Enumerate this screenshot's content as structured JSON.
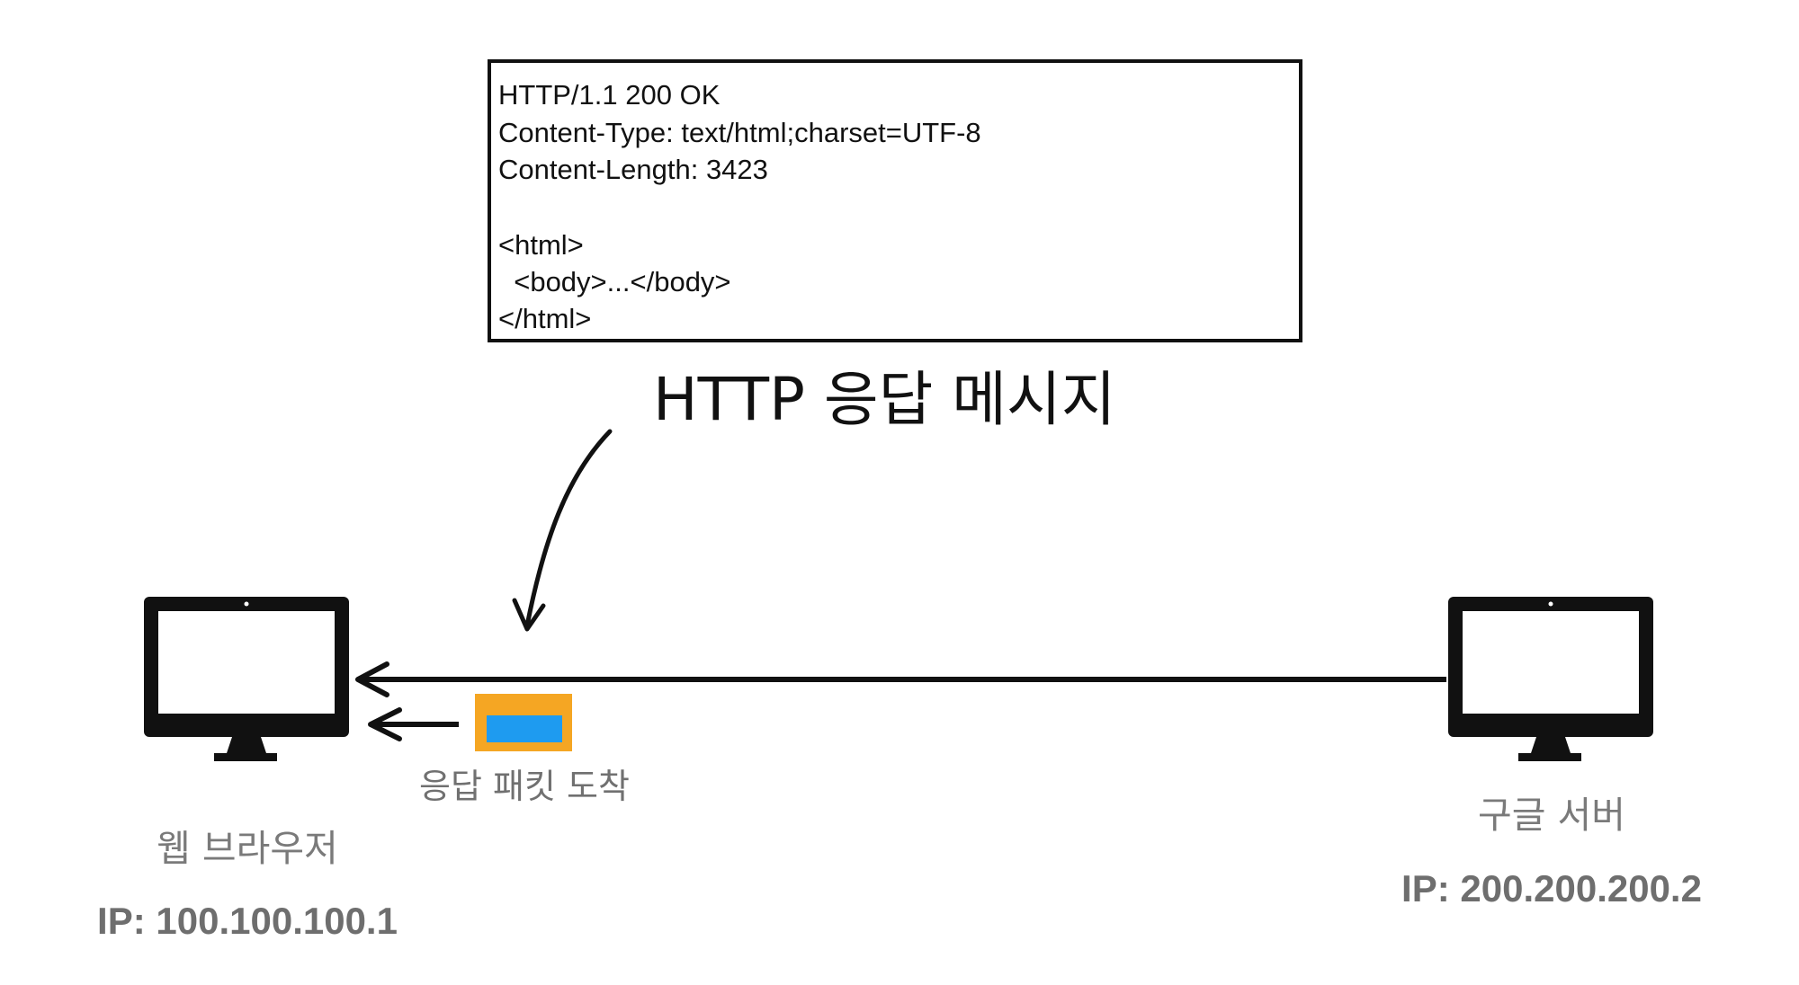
{
  "message": {
    "lines": [
      "HTTP/1.1 200 OK",
      "Content-Type: text/html;charset=UTF-8",
      "Content-Length: 3423",
      "<html>",
      "  <body>...</body>",
      "</html>"
    ]
  },
  "title": "HTTP 응답 메시지",
  "packet": {
    "label": "응답 패킷 도착",
    "outer_color": "#F5A623",
    "inner_color": "#1E9BF0"
  },
  "client": {
    "name": "웹 브라우저",
    "ip": "IP: 100.100.100.1",
    "icon": "monitor-icon"
  },
  "server": {
    "name": "구글 서버",
    "ip": "IP: 200.200.200.2",
    "icon": "monitor-icon"
  }
}
